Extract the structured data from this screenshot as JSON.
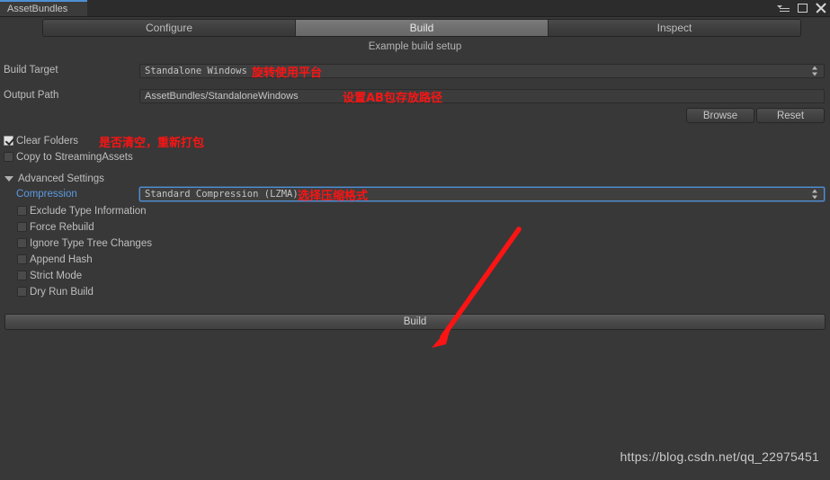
{
  "window": {
    "tab_title": "AssetBundles",
    "controls": {
      "menu_icon": "hamburger-menu-icon",
      "maximize_icon": "maximize-icon",
      "close_icon": "close-icon"
    }
  },
  "tabs": [
    {
      "label": "Configure",
      "active": false
    },
    {
      "label": "Build",
      "active": true
    },
    {
      "label": "Inspect",
      "active": false
    }
  ],
  "subtitle": "Example build setup",
  "fields": {
    "build_target": {
      "label": "Build Target",
      "value": "Standalone Windows",
      "annotation": "旋转使用平台"
    },
    "output_path": {
      "label": "Output Path",
      "value": "AssetBundles/StandaloneWindows",
      "annotation": "设置AB包存放路径"
    },
    "compression": {
      "label": "Compression",
      "value": "Standard Compression (LZMA)",
      "annotation": "选择压缩格式"
    }
  },
  "buttons": {
    "browse": "Browse",
    "reset": "Reset",
    "build": "Build"
  },
  "checkboxes": [
    {
      "label": "Clear Folders",
      "checked": true,
      "annotation": "是否清空，重新打包"
    },
    {
      "label": "Copy to StreamingAssets",
      "checked": false
    }
  ],
  "advanced": {
    "label": "Advanced Settings",
    "expanded": true,
    "options": [
      {
        "label": "Exclude Type Information",
        "checked": false
      },
      {
        "label": "Force Rebuild",
        "checked": false
      },
      {
        "label": "Ignore Type Tree Changes",
        "checked": false
      },
      {
        "label": "Append Hash",
        "checked": false
      },
      {
        "label": "Strict Mode",
        "checked": false
      },
      {
        "label": "Dry Run Build",
        "checked": false
      }
    ]
  },
  "watermark": "https://blog.csdn.net/qq_22975451",
  "colors": {
    "background": "#383838",
    "titlebar": "#2c2c2c",
    "accent_blue": "#4f8fd4",
    "annotation_red": "#fb1414",
    "text": "#bdbdbd"
  }
}
